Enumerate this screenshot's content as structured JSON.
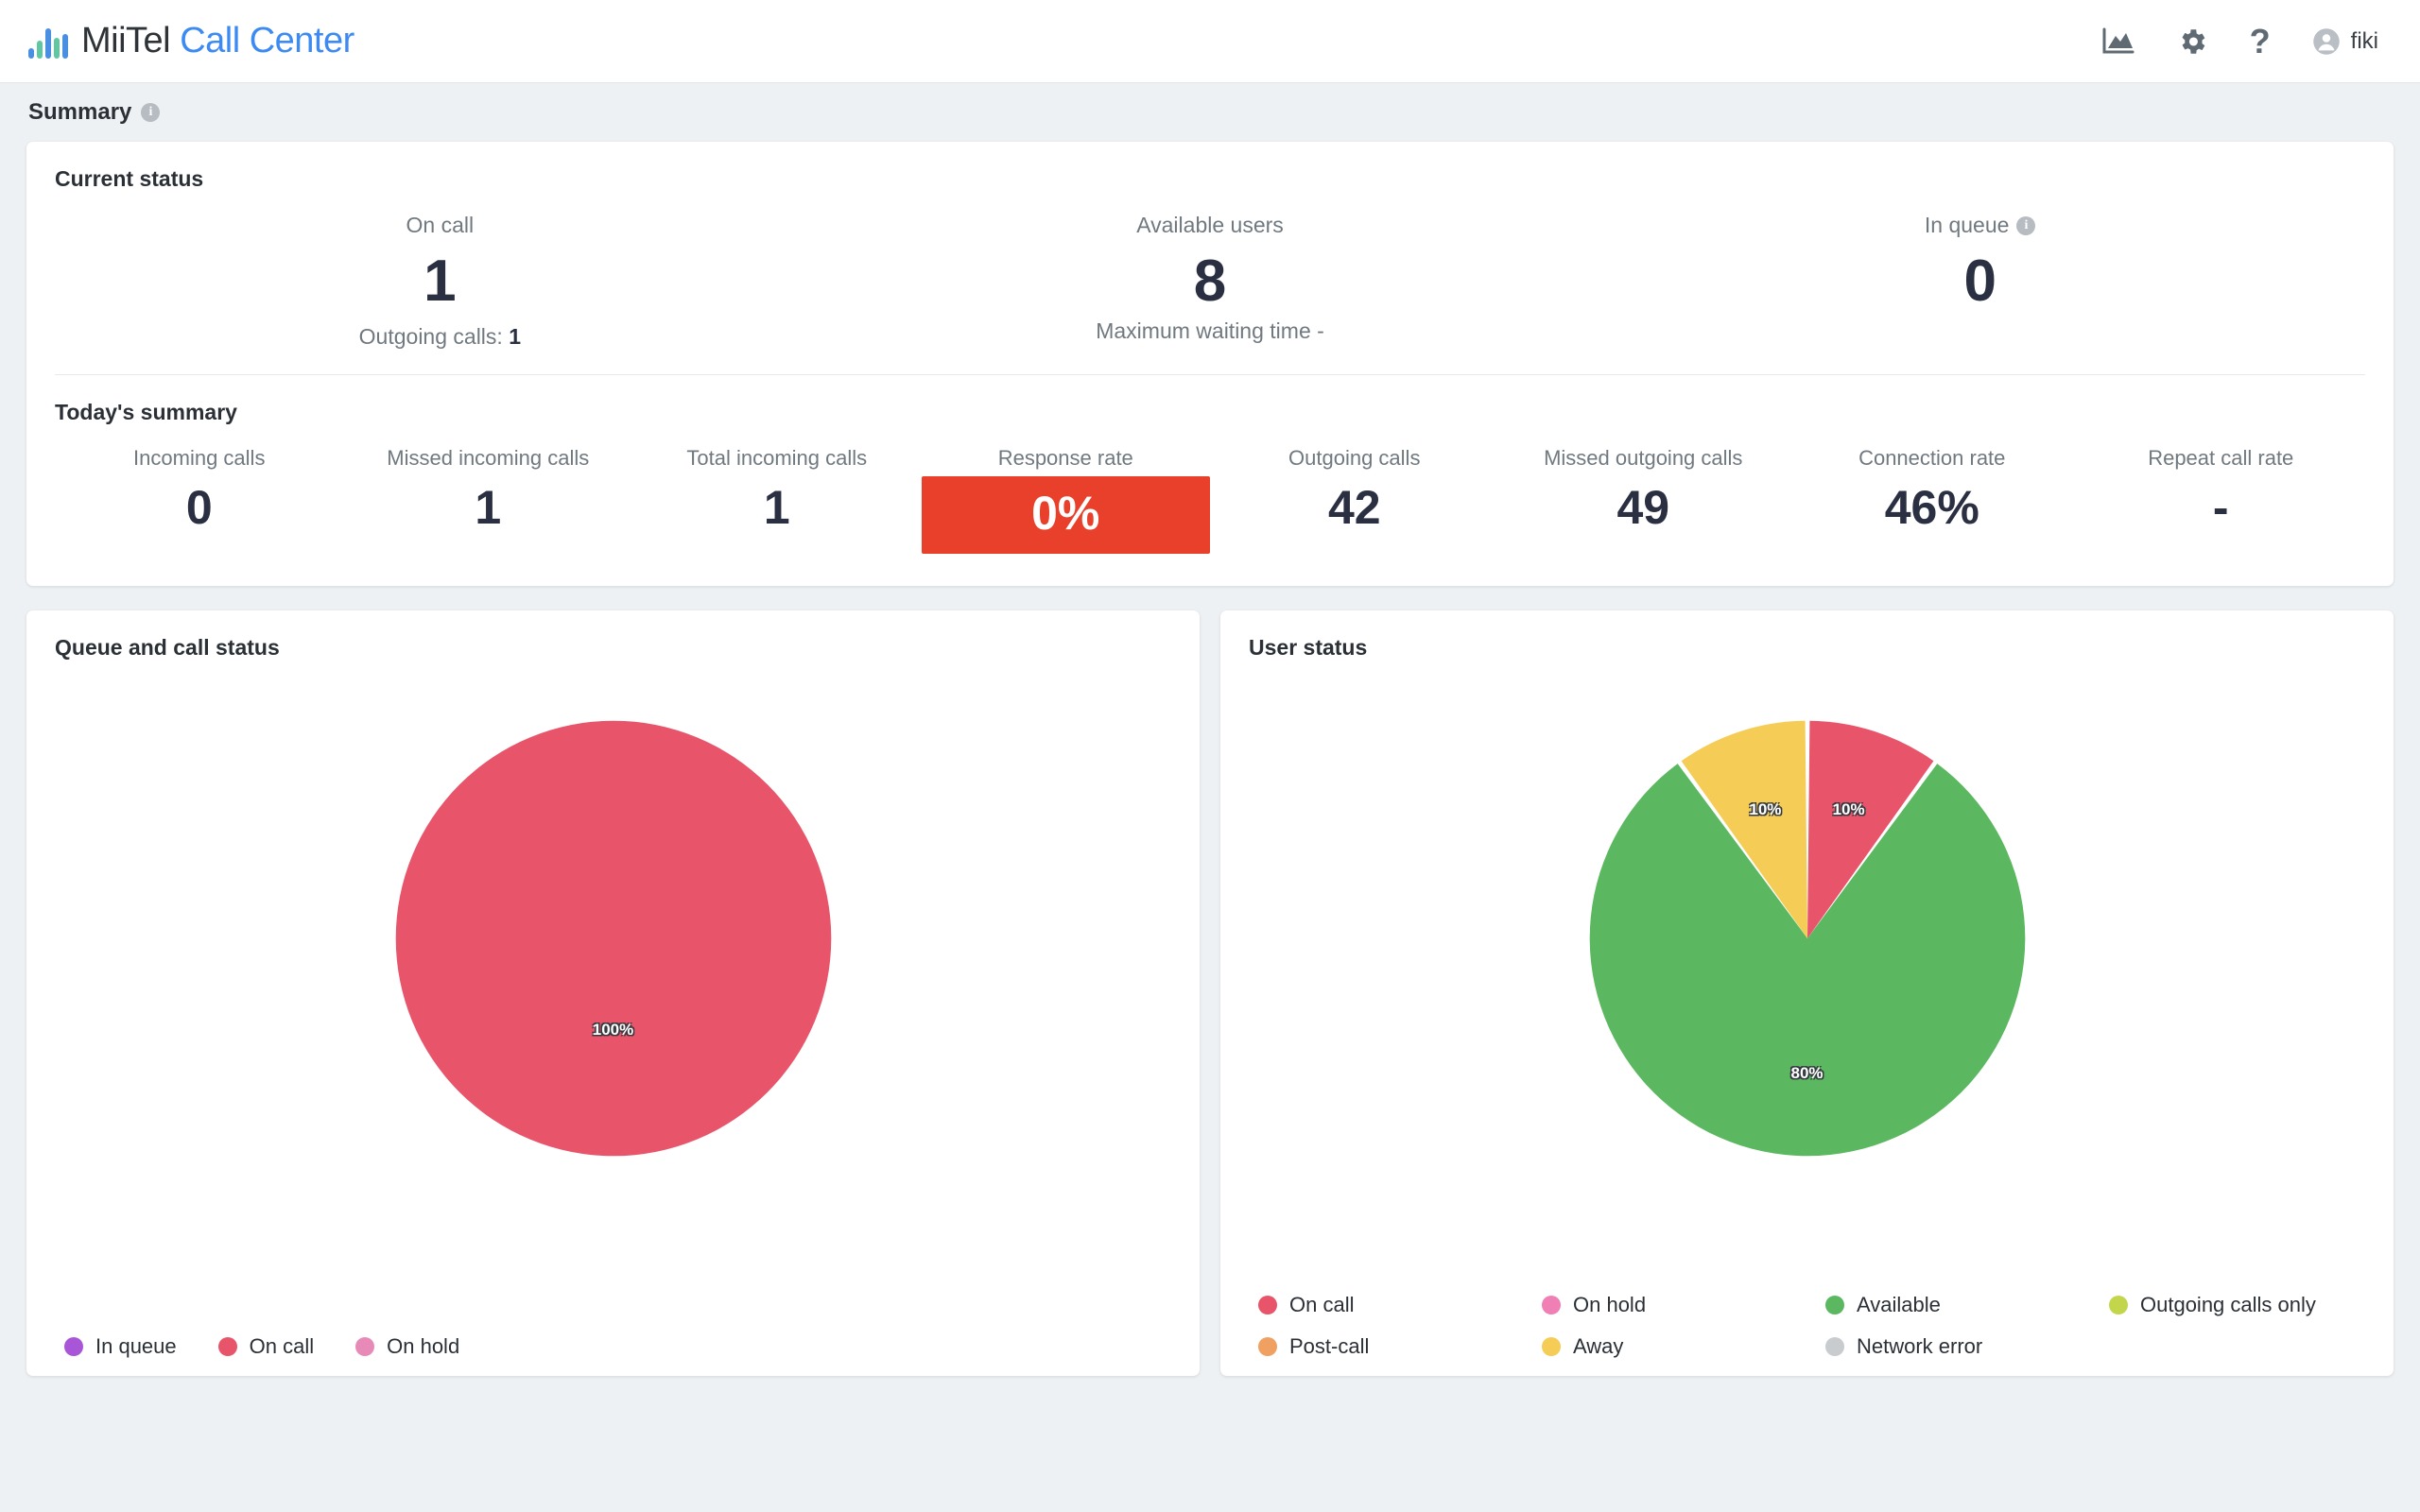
{
  "header": {
    "brand_dark": "MiiTel",
    "brand_blue": "Call Center",
    "icons": {
      "analytics": "analytics-icon",
      "settings": "gear-icon",
      "help": "?",
      "avatar": "user-avatar-icon"
    },
    "user_name": "fiki"
  },
  "summary": {
    "title": "Summary",
    "info": "i"
  },
  "current_status": {
    "title": "Current status",
    "metrics": [
      {
        "label": "On call",
        "value": "1",
        "sub_prefix": "Outgoing calls: ",
        "sub_value": "1",
        "has_info": false
      },
      {
        "label": "Available users",
        "value": "8",
        "has_info": false
      },
      {
        "label": "In queue",
        "value": "0",
        "has_info": true,
        "info": "i"
      }
    ],
    "max_waiting_time": "Maximum waiting time -"
  },
  "todays_summary": {
    "title": "Today's summary",
    "metrics": [
      {
        "label": "Incoming calls",
        "value": "0",
        "highlight": false
      },
      {
        "label": "Missed incoming calls",
        "value": "1",
        "highlight": false
      },
      {
        "label": "Total incoming calls",
        "value": "1",
        "highlight": false
      },
      {
        "label": "Response rate",
        "value": "0%",
        "highlight": true
      },
      {
        "label": "Outgoing calls",
        "value": "42",
        "highlight": false
      },
      {
        "label": "Missed outgoing calls",
        "value": "49",
        "highlight": false
      },
      {
        "label": "Connection rate",
        "value": "46%",
        "highlight": false
      },
      {
        "label": "Repeat call rate",
        "value": "-",
        "highlight": false
      }
    ]
  },
  "queue_panel": {
    "title": "Queue and call status",
    "legend": [
      {
        "label": "In queue",
        "color": "#a855d8"
      },
      {
        "label": "On call",
        "color": "#e8556a"
      },
      {
        "label": "On hold",
        "color": "#e88ab8"
      }
    ]
  },
  "user_panel": {
    "title": "User status",
    "legend": [
      {
        "label": "On call",
        "color": "#e8556a"
      },
      {
        "label": "On hold",
        "color": "#ef7fb4"
      },
      {
        "label": "Available",
        "color": "#5cb860"
      },
      {
        "label": "Outgoing calls only",
        "color": "#c3d64b"
      },
      {
        "label": "Post-call",
        "color": "#f0a060"
      },
      {
        "label": "Away",
        "color": "#f5cd56"
      },
      {
        "label": "Network error",
        "color": "#c8cccf"
      }
    ]
  },
  "chart_data": [
    {
      "type": "pie",
      "title": "Queue and call status",
      "categories": [
        "On call"
      ],
      "values": [
        100
      ],
      "labels": [
        "100%"
      ],
      "colors": [
        "#e8556a"
      ],
      "legend_position": "bottom-left",
      "legend_entries": [
        "In queue",
        "On call",
        "On hold"
      ]
    },
    {
      "type": "pie",
      "title": "User status",
      "categories": [
        "On call",
        "Available",
        "Away"
      ],
      "values": [
        10,
        80,
        10
      ],
      "labels": [
        "10%",
        "80%",
        "10%"
      ],
      "colors": [
        "#e8556a",
        "#5cb860",
        "#f5cd56"
      ],
      "legend_position": "bottom-left",
      "legend_entries": [
        "On call",
        "On hold",
        "Available",
        "Outgoing calls only",
        "Post-call",
        "Away",
        "Network error"
      ]
    }
  ]
}
